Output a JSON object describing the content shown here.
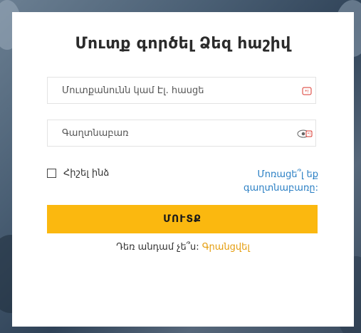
{
  "login": {
    "title": "Մուտք գործել Ձեզ հաշիվ",
    "username_placeholder": "Մուտքանունն կամ Էլ. հասցե",
    "password_placeholder": "Գաղտնաբառ",
    "remember_label": "Հիշել ինձ",
    "forgot_line1": "Մոռացե՞լ եք",
    "forgot_line2": "գաղտնաբառը:",
    "submit_label": "ՄՈՒՏՔ",
    "signup_prompt": "Դեռ անդամ չե՞ս:",
    "signup_link": "Գրանցվել"
  },
  "icons": {
    "username_field": "keyboard-icon",
    "password_field": "eye-icon"
  },
  "colors": {
    "accent": "#fbb80f",
    "link": "#2a7fc4",
    "signup_link": "#e49c0b",
    "icon_red": "#d9342b"
  }
}
